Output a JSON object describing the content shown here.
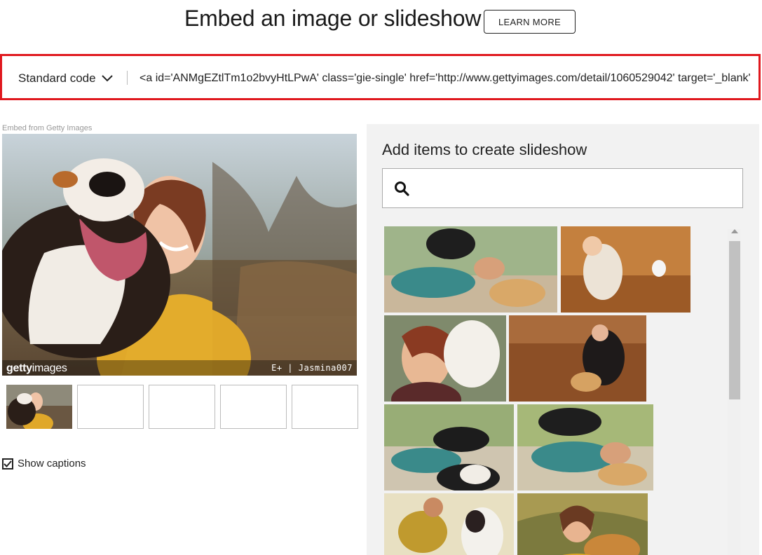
{
  "header": {
    "title": "Embed an image or slideshow",
    "learn_more_label": "LEARN MORE"
  },
  "code_bar": {
    "code_type_label": "Standard code",
    "code_text": "<a id='ANMgEZtlTm1o2bvyHtLPwA' class='gie-single' href='http://www.gettyimages.com/detail/1060529042' target='_blank'"
  },
  "embed": {
    "embed_from_label": "Embed from Getty Images",
    "logo_text_bold": "getty",
    "logo_text_regular": "images",
    "credit": "E+ | Jasmina007"
  },
  "options": {
    "show_captions_label": "Show captions",
    "show_captions_checked": true
  },
  "slideshow_panel": {
    "title": "Add items to create slideshow",
    "search_value": ""
  },
  "colors": {
    "highlight_border": "#e0181e",
    "panel_bg": "#f2f2f2"
  },
  "icons": {
    "dropdown": "chevron-down-icon",
    "search": "search-icon",
    "checkbox": "checkmark-icon"
  }
}
